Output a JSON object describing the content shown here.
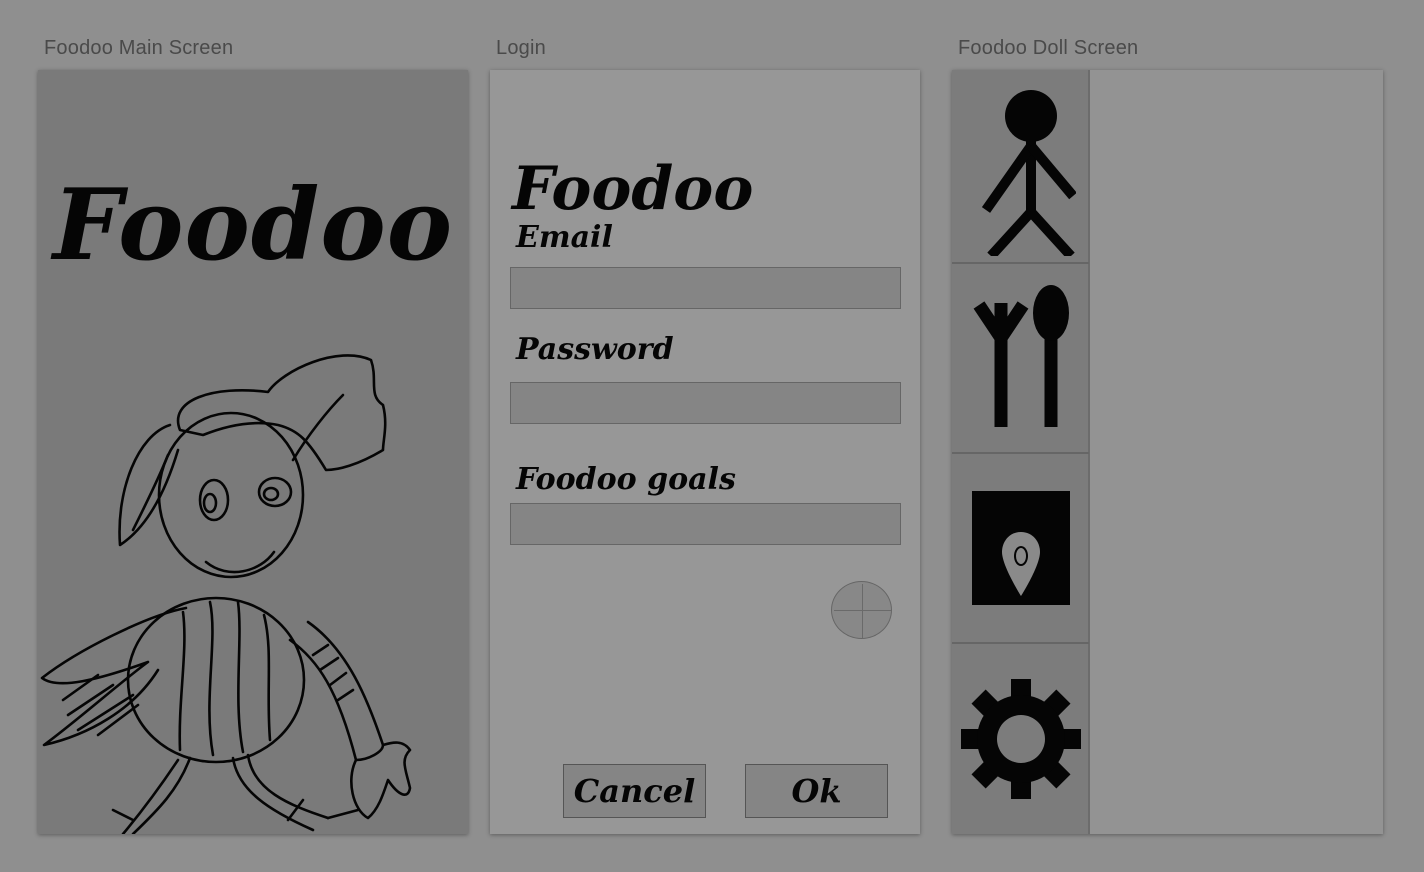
{
  "artboards": {
    "main_label": "Foodoo Main Screen",
    "login_label": "Login",
    "doll_label": "Foodoo Doll Screen"
  },
  "main_screen": {
    "title": "Foodoo"
  },
  "login": {
    "title": "Foodoo",
    "email_label": "Email",
    "email_value": "",
    "password_label": "Password",
    "password_value": "",
    "goals_label": "Foodoo goals",
    "goals_value": "",
    "cancel_label": "Cancel",
    "ok_label": "Ok"
  },
  "doll_screen": {
    "tabs": [
      {
        "icon": "stick-figure-icon"
      },
      {
        "icon": "fork-spoon-icon"
      },
      {
        "icon": "map-pin-icon"
      },
      {
        "icon": "gear-icon"
      }
    ]
  },
  "colors": {
    "background": "#8f8f8f",
    "panel": "#979797",
    "input": "#858585",
    "ink": "#050505"
  }
}
